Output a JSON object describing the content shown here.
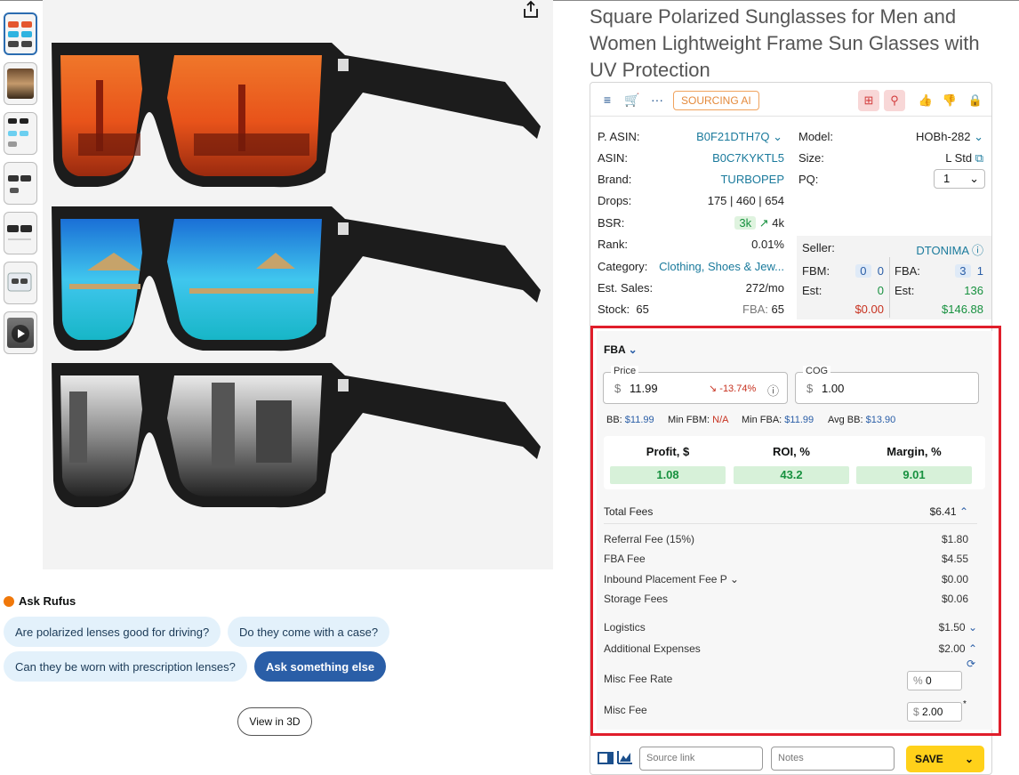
{
  "product_title": "Square Polarized Sunglasses for Men and Women Lightweight Frame Sun Glasses with UV Protection",
  "thumbnails": [
    "thumb-1",
    "thumb-2",
    "thumb-3",
    "thumb-4",
    "thumb-5",
    "thumb-6",
    "thumb-video"
  ],
  "rufus": {
    "title": "Ask Rufus",
    "chips": [
      "Are polarized lenses good for driving?",
      "Do they come with a case?",
      "Can they be worn with prescription lenses?",
      "Ask something else"
    ]
  },
  "view_3d_label": "View in 3D",
  "toolbar": {
    "sourcing_label": "SOURCING AI"
  },
  "info": {
    "p_asin_label": "P. ASIN:",
    "p_asin": "B0F21DTH7Q",
    "asin_label": "ASIN:",
    "asin": "B0C7KYKTL5",
    "brand_label": "Brand:",
    "brand": "TURBOPEP",
    "drops_label": "Drops:",
    "drops": "175 | 460 | 654",
    "bsr_label": "BSR:",
    "bsr_current": "3k",
    "bsr_other": "4k",
    "rank_label": "Rank:",
    "rank": "0.01%",
    "category_label": "Category:",
    "category": "Clothing, Shoes & Jew...",
    "est_sales_label": "Est. Sales:",
    "est_sales": "272/mo",
    "stock_label": "Stock:",
    "stock": "65",
    "fba_stock_label": "FBA:",
    "fba_stock": "65",
    "model_label": "Model:",
    "model": "HOBh-282",
    "size_label": "Size:",
    "size": "L Std",
    "pq_label": "PQ:",
    "pq": "1",
    "seller_label": "Seller:",
    "seller": "DTONIMA",
    "fbm_label": "FBM:",
    "fbm_a": "0",
    "fbm_b": "0",
    "fba_label": "FBA:",
    "fba_a": "3",
    "fba_b": "1",
    "est_label": "Est:",
    "fbm_est": "0",
    "fba_est": "136",
    "fbm_money": "$0.00",
    "fba_money": "$146.88"
  },
  "fba": {
    "mode": "FBA",
    "price_label": "Price",
    "currency": "$",
    "price": "11.99",
    "price_change": "-13.74%",
    "cog_label": "COG",
    "cog": "1.00",
    "bb_label": "BB:",
    "bb": "$11.99",
    "min_fbm_label": "Min FBM:",
    "min_fbm": "N/A",
    "min_fba_label": "Min FBA:",
    "min_fba": "$11.99",
    "avg_bb_label": "Avg BB:",
    "avg_bb": "$13.90",
    "profit_label": "Profit, $",
    "profit": "1.08",
    "roi_label": "ROI, %",
    "roi": "43.2",
    "margin_label": "Margin, %",
    "margin": "9.01",
    "total_fees_label": "Total Fees",
    "total_fees": "$6.41",
    "referral_fee_label": "Referral Fee (15%)",
    "referral_fee": "$1.80",
    "fba_fee_label": "FBA Fee",
    "fba_fee": "$4.55",
    "inbound_label": "Inbound Placement Fee P",
    "inbound": "$0.00",
    "storage_label": "Storage Fees",
    "storage": "$0.06",
    "logistics_label": "Logistics",
    "logistics": "$1.50",
    "additional_label": "Additional Expenses",
    "additional": "$2.00",
    "misc_rate_label": "Misc Fee Rate",
    "misc_rate_unit": "%",
    "misc_rate": "0",
    "misc_fee_label": "Misc Fee",
    "misc_fee_unit": "$",
    "misc_fee": "2.00"
  },
  "bottom": {
    "source_placeholder": "Source link",
    "notes_placeholder": "Notes",
    "save_label": "SAVE"
  },
  "colors": {
    "highlight": "#e01e2b",
    "save": "#ffd11a",
    "link": "#1a7a9c",
    "positive": "#17913f"
  }
}
